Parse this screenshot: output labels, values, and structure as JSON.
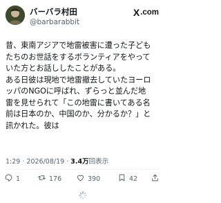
{
  "user": {
    "display_name": "バーバラ村田",
    "handle": "@barbarabbit"
  },
  "brand": {
    "logo": "X",
    "suffix": ".com"
  },
  "tweet": {
    "lines": [
      "昔、東南アジアで地雷被害に遭った子ども",
      "たちのお世話をするボランティアをやって",
      "いた方とお話ししたことがある。",
      "ある日彼は現地で地雷撤去していたヨーロ",
      "ッパのNGOに呼ばれ、ずらっと並んだ地",
      "雷を見せられて「この地雷に書いてある名",
      "前は日本のか、中国のか、分かるか？」と",
      "訊かれた。彼は"
    ]
  },
  "meta": {
    "time": "1:29",
    "date": "2026/08/19",
    "views_count": "3.4万",
    "views_label": "回表示"
  },
  "actions": {
    "replies": "1",
    "reposts": "176",
    "likes": "390",
    "bookmarks": "42"
  },
  "icons": [
    "x-logo-icon",
    "reply-icon",
    "repost-icon",
    "like-icon",
    "bookmark-icon",
    "share-icon",
    "loading-spinner-icon"
  ]
}
